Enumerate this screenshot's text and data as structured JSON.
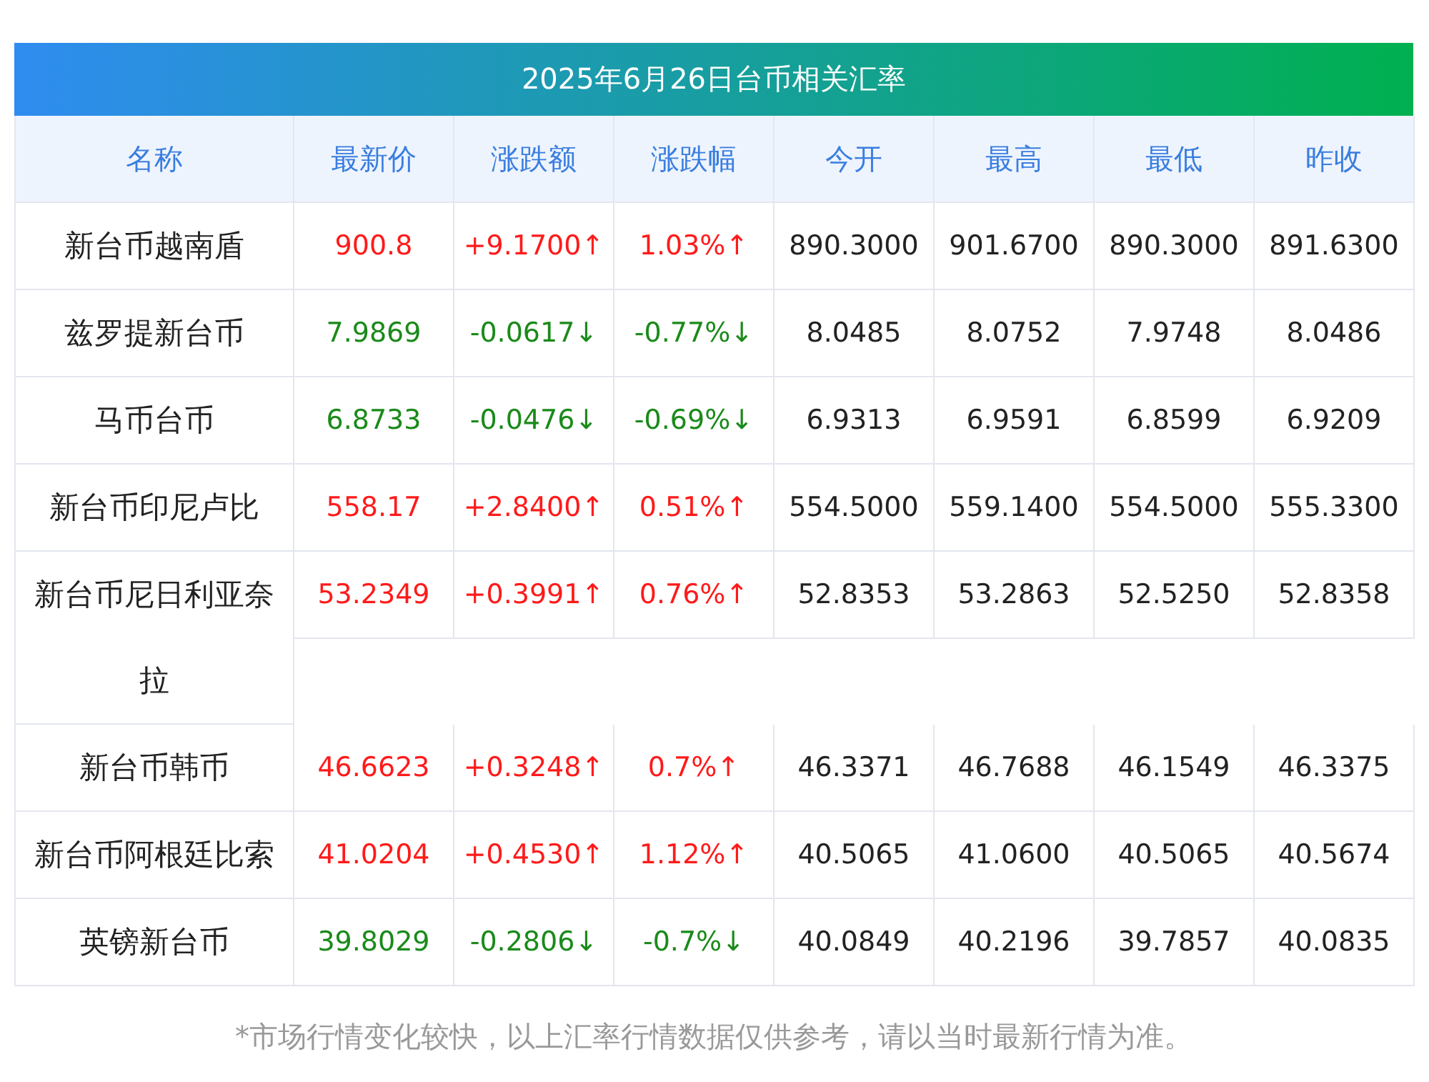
{
  "title": "2025年6月26日台币相关汇率",
  "columns": [
    "名称",
    "最新价",
    "涨跌额",
    "涨跌幅",
    "今开",
    "最高",
    "最低",
    "昨收"
  ],
  "rows": [
    {
      "color": "#ff1a1a",
      "cells": [
        "新台币越南盾",
        "900.8",
        "+9.1700↑",
        "1.03%↑",
        "890.3000",
        "901.6700",
        "890.3000",
        "891.6300"
      ]
    },
    {
      "color": "#1a8a1a",
      "cells": [
        "兹罗提新台币",
        "7.9869",
        "-0.0617↓",
        "-0.77%↓",
        "8.0485",
        "8.0752",
        "7.9748",
        "8.0486"
      ]
    },
    {
      "color": "#1a8a1a",
      "cells": [
        "马币台币",
        "6.8733",
        "-0.0476↓",
        "-0.69%↓",
        "6.9313",
        "6.9591",
        "6.8599",
        "6.9209"
      ]
    },
    {
      "color": "#ff1a1a",
      "cells": [
        "新台币印尼卢比",
        "558.17",
        "+2.8400↑",
        "0.51%↑",
        "554.5000",
        "559.1400",
        "554.5000",
        "555.3300"
      ]
    },
    {
      "color": "#ff1a1a",
      "cells": [
        "新台币尼日利亚奈拉",
        "53.2349",
        "+0.3991↑",
        "0.76%↑",
        "52.8353",
        "53.2863",
        "52.5250",
        "52.8358"
      ]
    },
    {
      "color": "#ff1a1a",
      "cells": [
        "新台币韩币",
        "46.6623",
        "+0.3248↑",
        "0.7%↑",
        "46.3371",
        "46.7688",
        "46.1549",
        "46.3375"
      ]
    },
    {
      "color": "#ff1a1a",
      "cells": [
        "新台币阿根廷比索",
        "41.0204",
        "+0.4530↑",
        "1.12%↑",
        "40.5065",
        "41.0600",
        "40.5065",
        "40.5674"
      ]
    },
    {
      "color": "#1a8a1a",
      "cells": [
        "英镑新台币",
        "39.8029",
        "-0.2806↓",
        "-0.7%↓",
        "40.0849",
        "40.2196",
        "39.7857",
        "40.0835"
      ]
    }
  ],
  "note": "*市场行情变化较快，以上汇率行情数据仅供参考，请以当时最新行情为准。"
}
